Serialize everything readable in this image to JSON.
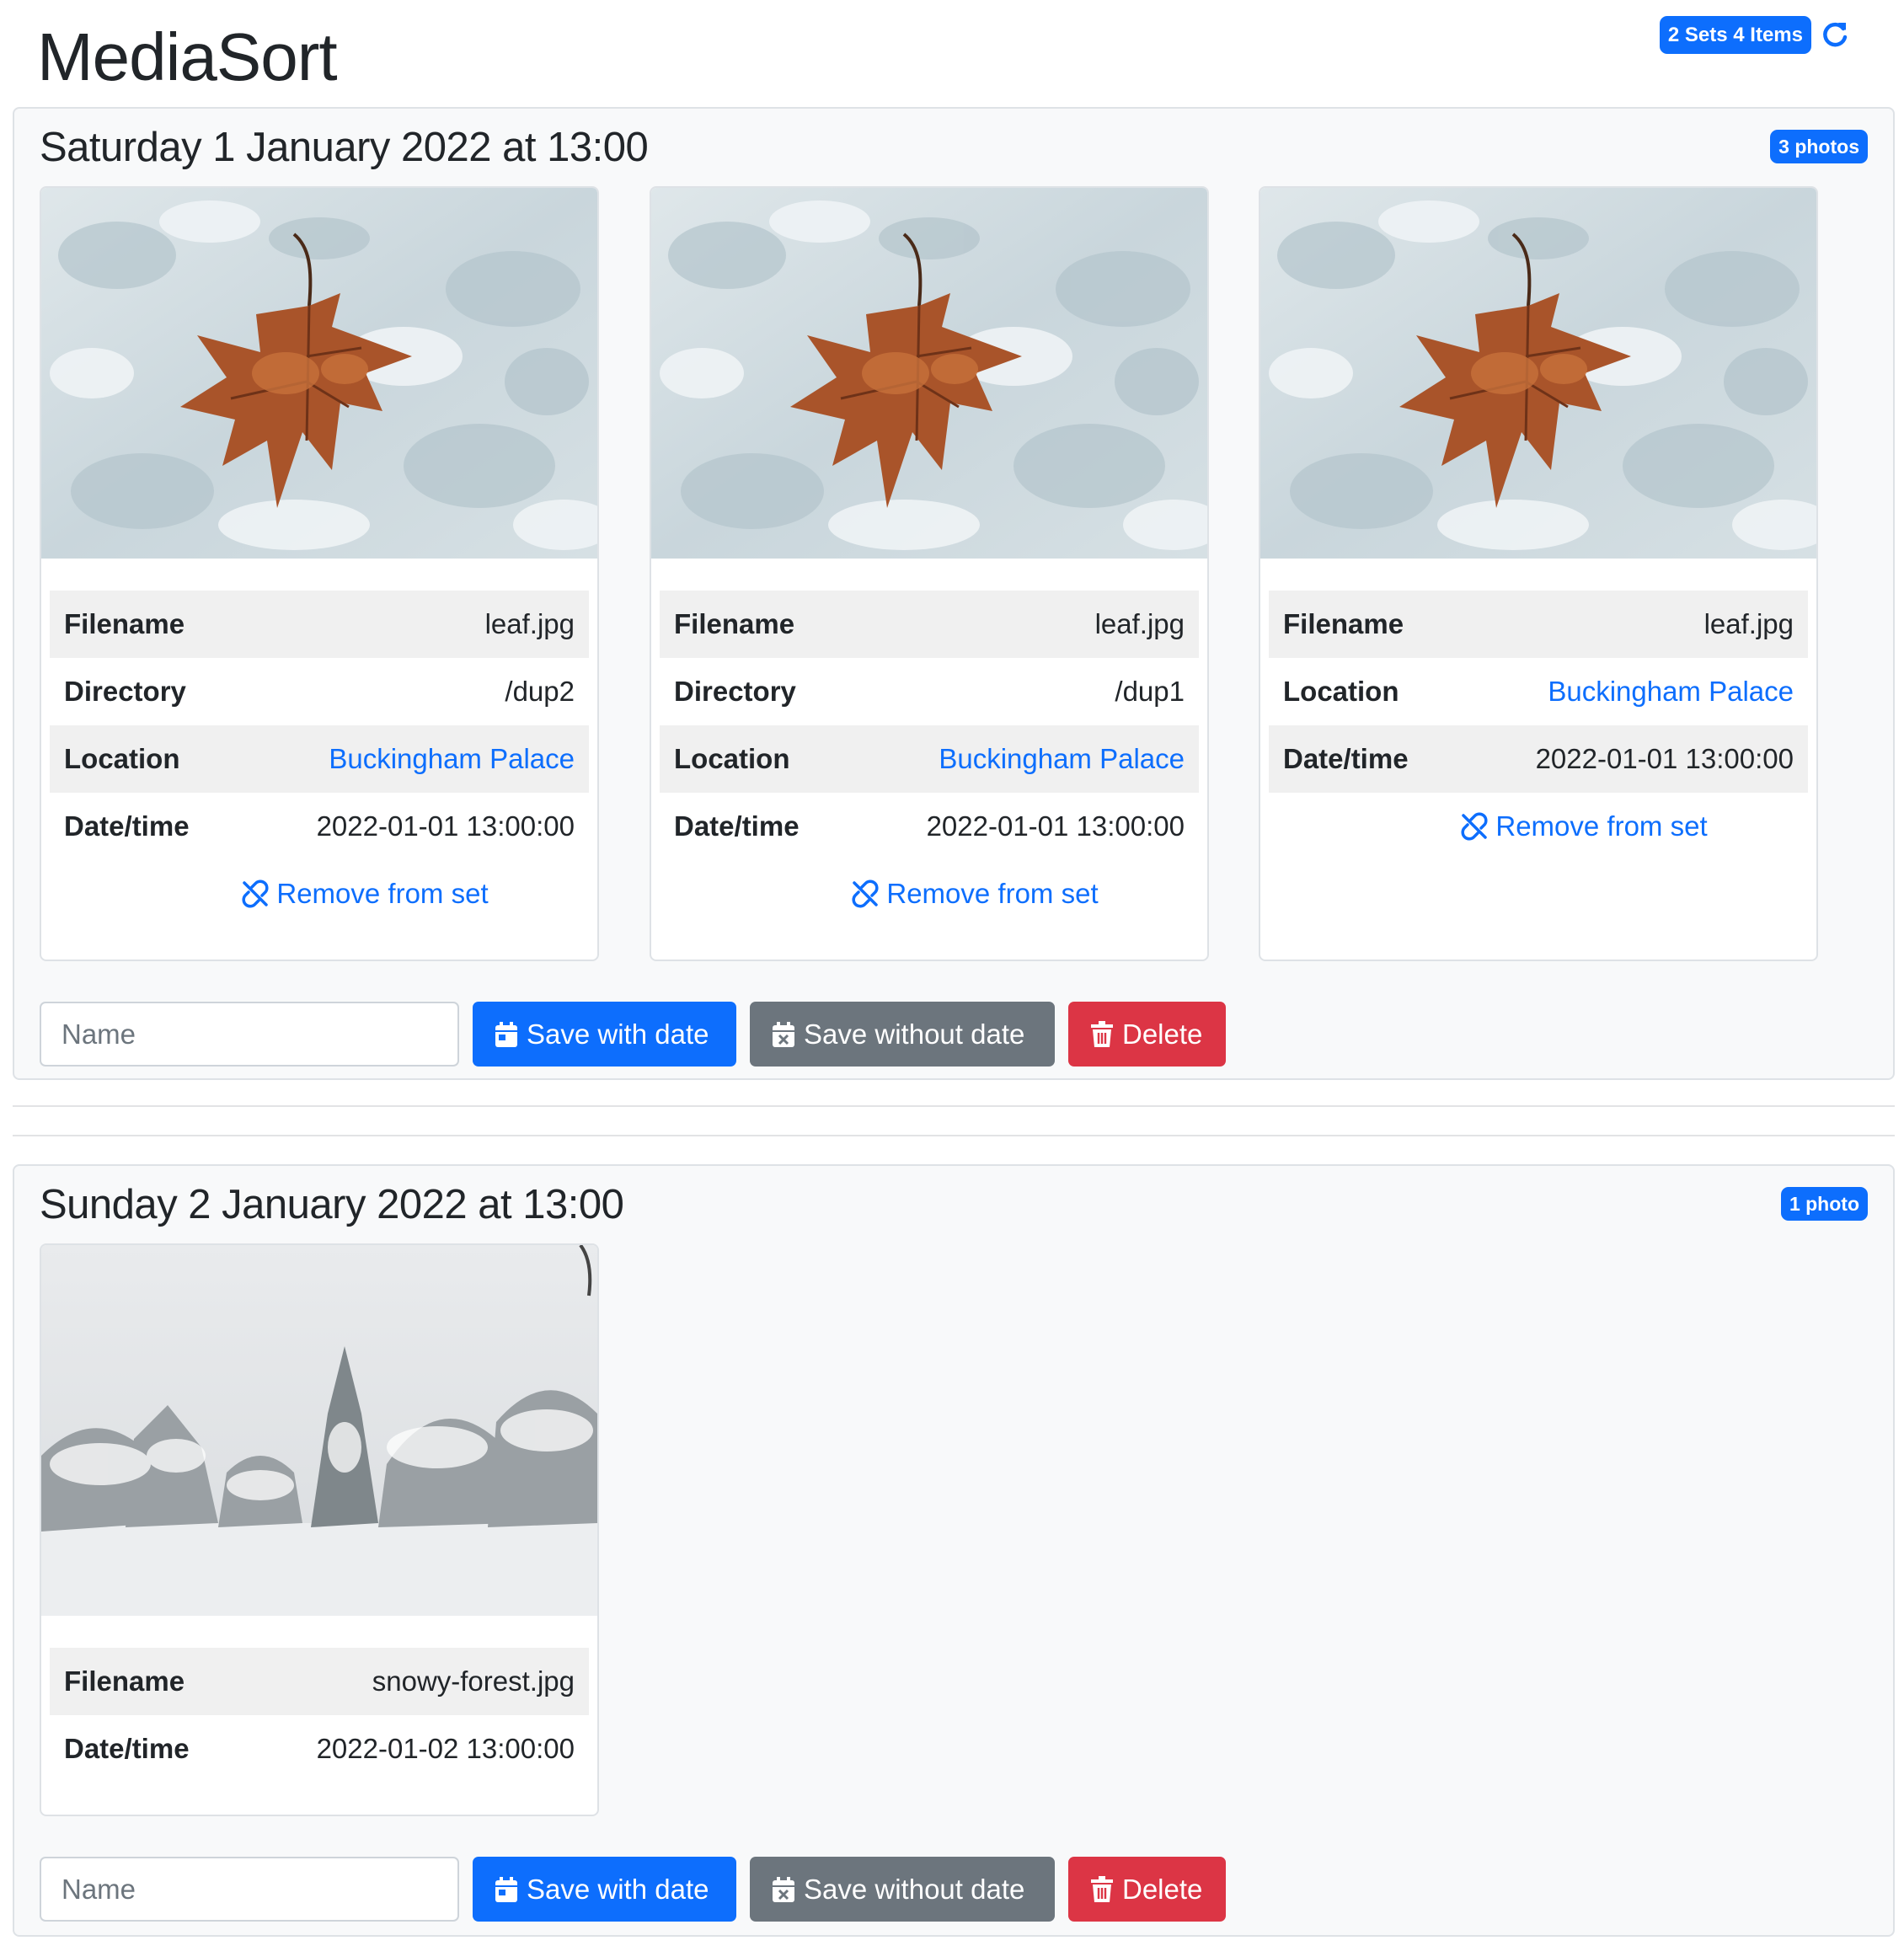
{
  "app": {
    "title": "MediaSort"
  },
  "summary": {
    "badge": "2 Sets 4 Items",
    "refresh_icon": "refresh-icon"
  },
  "labels": {
    "filename": "Filename",
    "directory": "Directory",
    "location": "Location",
    "datetime": "Date/time",
    "remove": "Remove from set",
    "name_placeholder": "Name",
    "save_with_date": "Save with date",
    "save_without_date": "Save without date",
    "delete": "Delete"
  },
  "sets": [
    {
      "title": "Saturday 1 January 2022 at 13:00",
      "badge": "3 photos",
      "photos": [
        {
          "image": "maple-leaf-on-snow",
          "filename": "leaf.jpg",
          "directory": "/dup2",
          "location": "Buckingham Palace",
          "datetime": "2022-01-01 13:00:00"
        },
        {
          "image": "maple-leaf-on-snow",
          "filename": "leaf.jpg",
          "directory": "/dup1",
          "location": "Buckingham Palace",
          "datetime": "2022-01-01 13:00:00"
        },
        {
          "image": "maple-leaf-on-snow",
          "filename": "leaf.jpg",
          "location": "Buckingham Palace",
          "datetime": "2022-01-01 13:00:00"
        }
      ]
    },
    {
      "title": "Sunday 2 January 2022 at 13:00",
      "badge": "1 photo",
      "photos": [
        {
          "image": "snowy-forest",
          "filename": "snowy-forest.jpg",
          "datetime": "2022-01-02 13:00:00"
        }
      ]
    }
  ],
  "colors": {
    "primary": "#0d6efd",
    "secondary": "#6c757d",
    "danger": "#dc3545",
    "card_bg": "#f8f9fa",
    "stripe": "#f0f0f0"
  }
}
